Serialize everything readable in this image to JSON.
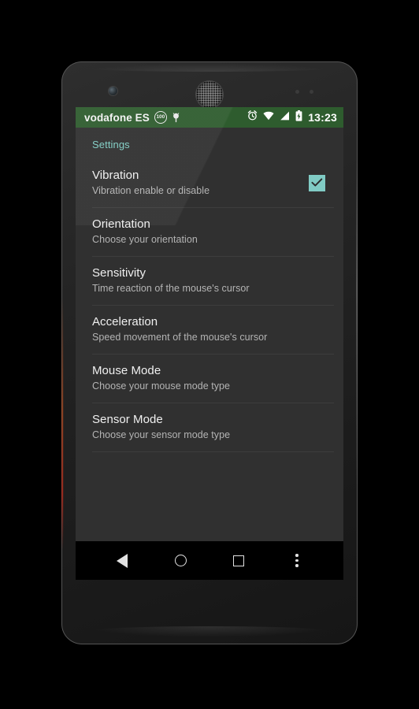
{
  "device": {
    "hardware": {
      "front_camera": "front-camera",
      "earpiece": "earpiece-speaker",
      "proximity_sensor": "proximity-sensor"
    }
  },
  "status_bar": {
    "carrier": "vodafone ES",
    "data_badge": "100",
    "android_icon": "android-robot-icon",
    "icons": [
      "alarm-icon",
      "wifi-icon",
      "signal-icon",
      "battery-charging-icon"
    ],
    "time": "13:23",
    "background_color": "#2e5c2e"
  },
  "screen": {
    "section_header": "Settings",
    "accent_color": "#7fcdc4",
    "background_color": "#303030",
    "preferences": [
      {
        "title": "Vibration",
        "summary": "Vibration enable or disable",
        "widget": "checkbox",
        "checked": true
      },
      {
        "title": "Orientation",
        "summary": "Choose your orientation",
        "widget": "none",
        "checked": false
      },
      {
        "title": "Sensitivity",
        "summary": "Time reaction of the mouse's cursor",
        "widget": "none",
        "checked": false
      },
      {
        "title": "Acceleration",
        "summary": "Speed movement of the mouse's cursor",
        "widget": "none",
        "checked": false
      },
      {
        "title": "Mouse Mode",
        "summary": "Choose your mouse mode type",
        "widget": "none",
        "checked": false
      },
      {
        "title": "Sensor Mode",
        "summary": "Choose your sensor mode type",
        "widget": "none",
        "checked": false
      }
    ]
  },
  "nav_bar": {
    "buttons": [
      {
        "name": "back",
        "icon": "back-triangle-icon"
      },
      {
        "name": "home",
        "icon": "home-circle-icon"
      },
      {
        "name": "recents",
        "icon": "recents-square-icon"
      },
      {
        "name": "overflow",
        "icon": "overflow-menu-icon"
      }
    ]
  }
}
